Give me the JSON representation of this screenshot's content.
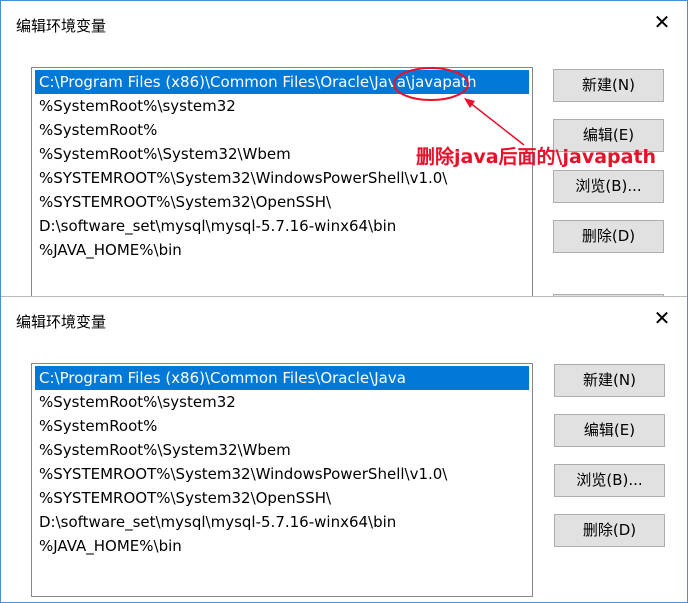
{
  "top_dialog": {
    "title": "编辑环境变量",
    "close_glyph": "✕",
    "items": [
      "C:\\Program Files (x86)\\Common Files\\Oracle\\Java\\javapath",
      "%SystemRoot%\\system32",
      "%SystemRoot%",
      "%SystemRoot%\\System32\\Wbem",
      "%SYSTEMROOT%\\System32\\WindowsPowerShell\\v1.0\\",
      "%SYSTEMROOT%\\System32\\OpenSSH\\",
      "D:\\software_set\\mysql\\mysql-5.7.16-winx64\\bin",
      "%JAVA_HOME%\\bin"
    ],
    "buttons": {
      "new": "新建(N)",
      "edit": "编辑(E)",
      "browse": "浏览(B)...",
      "delete": "删除(D)"
    },
    "annotation": "删除java后面的\\javapath"
  },
  "bottom_dialog": {
    "title": "编辑环境变量",
    "close_glyph": "✕",
    "items": [
      "C:\\Program Files (x86)\\Common Files\\Oracle\\Java",
      "%SystemRoot%\\system32",
      "%SystemRoot%",
      "%SystemRoot%\\System32\\Wbem",
      "%SYSTEMROOT%\\System32\\WindowsPowerShell\\v1.0\\",
      "%SYSTEMROOT%\\System32\\OpenSSH\\",
      "D:\\software_set\\mysql\\mysql-5.7.16-winx64\\bin",
      "%JAVA_HOME%\\bin"
    ],
    "buttons": {
      "new": "新建(N)",
      "edit": "编辑(E)",
      "browse": "浏览(B)...",
      "delete": "删除(D)"
    }
  },
  "colors": {
    "selection": "#0078d7",
    "annotation": "#e8102a",
    "frame": "#4a90d9"
  }
}
